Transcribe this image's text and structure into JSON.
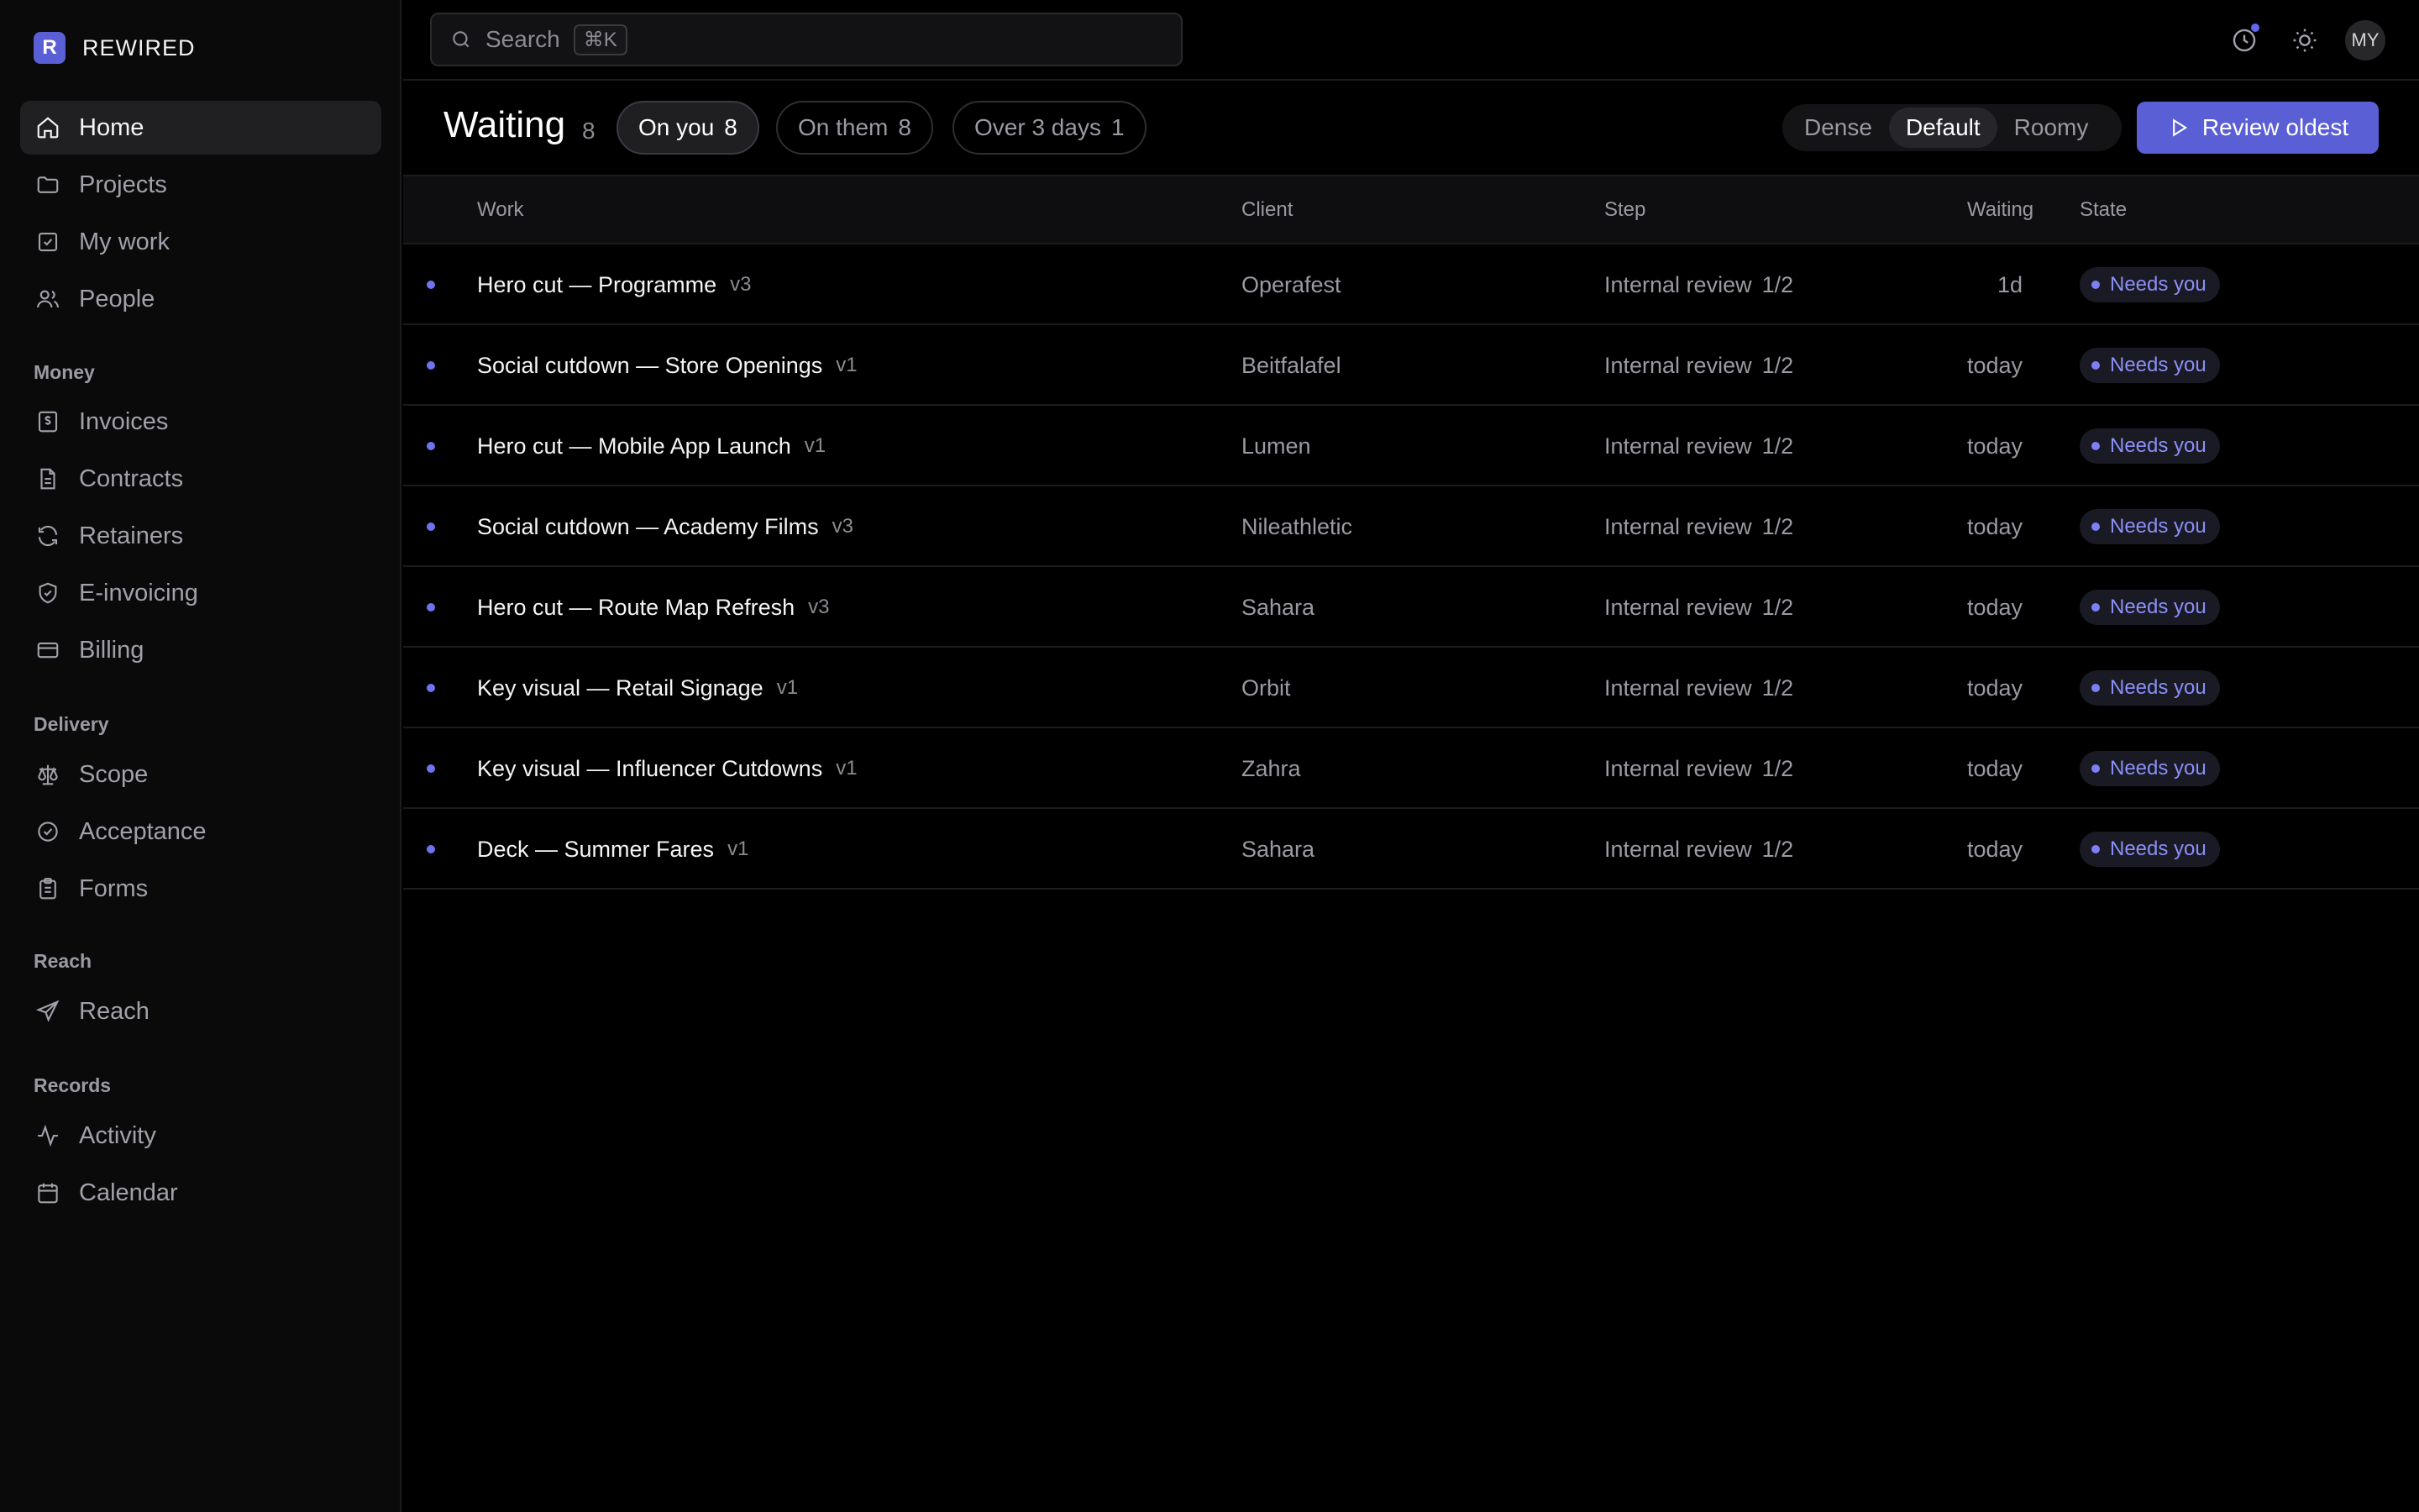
{
  "app": {
    "logo_letter": "R",
    "name": "REWIRED"
  },
  "sidebar": {
    "top_items": [
      {
        "label": "Home",
        "icon": "home-icon"
      },
      {
        "label": "Projects",
        "icon": "folder-icon"
      },
      {
        "label": "My work",
        "icon": "checkbox-icon"
      },
      {
        "label": "People",
        "icon": "users-icon"
      }
    ],
    "sections": [
      {
        "title": "Money",
        "items": [
          {
            "label": "Invoices",
            "icon": "invoice-icon"
          },
          {
            "label": "Contracts",
            "icon": "document-icon"
          },
          {
            "label": "Retainers",
            "icon": "refresh-icon"
          },
          {
            "label": "E-invoicing",
            "icon": "shield-check-icon"
          },
          {
            "label": "Billing",
            "icon": "credit-card-icon"
          }
        ]
      },
      {
        "title": "Delivery",
        "items": [
          {
            "label": "Scope",
            "icon": "scale-icon"
          },
          {
            "label": "Acceptance",
            "icon": "check-circle-icon"
          },
          {
            "label": "Forms",
            "icon": "clipboard-icon"
          }
        ]
      },
      {
        "title": "Reach",
        "items": [
          {
            "label": "Reach",
            "icon": "send-icon"
          }
        ]
      },
      {
        "title": "Records",
        "items": [
          {
            "label": "Activity",
            "icon": "activity-icon"
          },
          {
            "label": "Calendar",
            "icon": "calendar-icon"
          }
        ]
      }
    ]
  },
  "search": {
    "placeholder": "Search",
    "shortcut": "⌘K"
  },
  "user": {
    "initials": "MY"
  },
  "header": {
    "title": "Waiting",
    "count": "8",
    "filters": [
      {
        "label": "On you",
        "count": "8",
        "active": true
      },
      {
        "label": "On them",
        "count": "8",
        "active": false
      },
      {
        "label": "Over 3 days",
        "count": "1",
        "active": false
      }
    ],
    "density": {
      "options": [
        "Dense",
        "Default",
        "Roomy"
      ],
      "selected": "Default"
    },
    "primary_action": "Review oldest"
  },
  "table": {
    "columns": {
      "work": "Work",
      "client": "Client",
      "step": "Step",
      "waiting": "Waiting",
      "state": "State"
    },
    "rows": [
      {
        "title": "Hero cut — Programme",
        "version": "v3",
        "client": "Operafest",
        "step": "Internal review",
        "step_progress": "1/2",
        "waiting": "1d",
        "state": "Needs you"
      },
      {
        "title": "Social cutdown — Store Openings",
        "version": "v1",
        "client": "Beitfalafel",
        "step": "Internal review",
        "step_progress": "1/2",
        "waiting": "today",
        "state": "Needs you"
      },
      {
        "title": "Hero cut — Mobile App Launch",
        "version": "v1",
        "client": "Lumen",
        "step": "Internal review",
        "step_progress": "1/2",
        "waiting": "today",
        "state": "Needs you"
      },
      {
        "title": "Social cutdown — Academy Films",
        "version": "v3",
        "client": "Nileathletic",
        "step": "Internal review",
        "step_progress": "1/2",
        "waiting": "today",
        "state": "Needs you"
      },
      {
        "title": "Hero cut — Route Map Refresh",
        "version": "v3",
        "client": "Sahara",
        "step": "Internal review",
        "step_progress": "1/2",
        "waiting": "today",
        "state": "Needs you"
      },
      {
        "title": "Key visual — Retail Signage",
        "version": "v1",
        "client": "Orbit",
        "step": "Internal review",
        "step_progress": "1/2",
        "waiting": "today",
        "state": "Needs you"
      },
      {
        "title": "Key visual — Influencer Cutdowns",
        "version": "v1",
        "client": "Zahra",
        "step": "Internal review",
        "step_progress": "1/2",
        "waiting": "today",
        "state": "Needs you"
      },
      {
        "title": "Deck — Summer Fares",
        "version": "v1",
        "client": "Sahara",
        "step": "Internal review",
        "step_progress": "1/2",
        "waiting": "today",
        "state": "Needs you"
      }
    ]
  },
  "colors": {
    "accent": "#5b5fd6",
    "background": "#000000",
    "sidebar": "#0a0a0b",
    "state_text": "#8b8ff7"
  }
}
